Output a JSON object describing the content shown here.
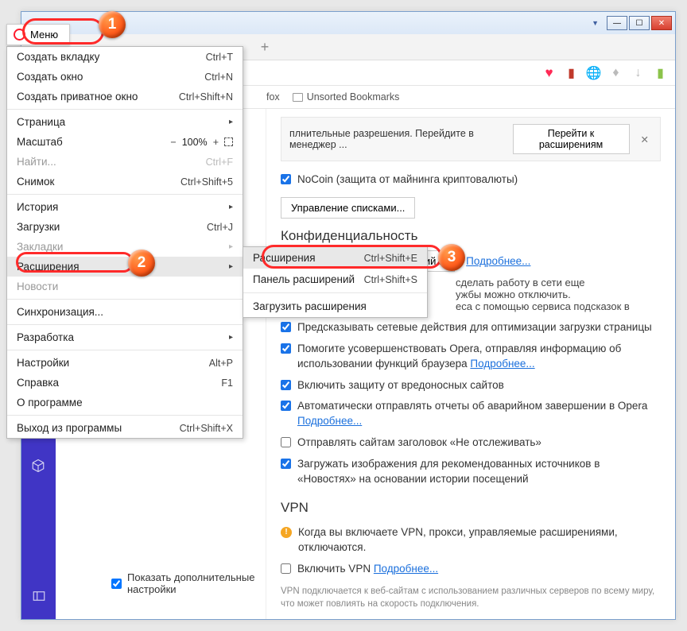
{
  "menu_button": "Меню",
  "bookmark_folders": [
    "fox",
    "Unsorted Bookmarks"
  ],
  "show_advanced": "Показать дополнительные настройки",
  "menu": {
    "new_tab": {
      "label": "Создать вкладку",
      "shortcut": "Ctrl+T"
    },
    "new_window": {
      "label": "Создать окно",
      "shortcut": "Ctrl+N"
    },
    "new_private": {
      "label": "Создать приватное окно",
      "shortcut": "Ctrl+Shift+N"
    },
    "page": {
      "label": "Страница"
    },
    "zoom_label": "Масштаб",
    "zoom_value": "100%",
    "find": {
      "label": "Найти...",
      "shortcut": "Ctrl+F"
    },
    "snapshot": {
      "label": "Снимок",
      "shortcut": "Ctrl+Shift+5"
    },
    "history": {
      "label": "История"
    },
    "downloads": {
      "label": "Загрузки",
      "shortcut": "Ctrl+J"
    },
    "bookmarks": {
      "label": "Закладки"
    },
    "extensions": {
      "label": "Расширения"
    },
    "news": {
      "label": "Новости"
    },
    "sync": {
      "label": "Синхронизация..."
    },
    "develop": {
      "label": "Разработка"
    },
    "settings": {
      "label": "Настройки",
      "shortcut": "Alt+P"
    },
    "help": {
      "label": "Справка",
      "shortcut": "F1"
    },
    "about": {
      "label": "О программе"
    },
    "exit": {
      "label": "Выход из программы",
      "shortcut": "Ctrl+Shift+X"
    }
  },
  "submenu": {
    "extensions": {
      "label": "Расширения",
      "shortcut": "Ctrl+Shift+E"
    },
    "panel": {
      "label": "Панель расширений",
      "shortcut": "Ctrl+Shift+S"
    },
    "load": {
      "label": "Загрузить расширения"
    }
  },
  "notice": {
    "text": "плнительные разрешения. Перейдите в менеджер ...",
    "button": "Перейти к расширениям"
  },
  "nocoin": "NoCoin (защита от майнинга криптовалюты)",
  "manage_lists": "Управление списками...",
  "privacy_h": "Конфиденциальность",
  "clear_history": "Очистить историю посещений...",
  "more": "Подробнее...",
  "priv_txt1": "сделать работу в сети еще",
  "priv_txt2": "ужбы можно отключить.",
  "priv_txt3": "еса с помощью сервиса подсказок в",
  "predict": "Предсказывать сетевые действия для оптимизации загрузки страницы",
  "help_improve": "Помогите усовершенствовать Opera, отправляя информацию об использовании функций браузера",
  "malware": "Включить защиту от вредоносных сайтов",
  "crash": "Автоматически отправлять отчеты об аварийном завершении в Opera",
  "dnt": "Отправлять сайтам заголовок «Не отслеживать»",
  "news_img": "Загружать изображения для рекомендованных источников в «Новостях» на основании истории посещений",
  "vpn_h": "VPN",
  "vpn_warn": "Когда вы включаете VPN, прокси, управляемые расширениями, отключаются.",
  "vpn_enable": "Включить VPN",
  "vpn_note": "VPN подключается к веб-сайтам с использованием различных серверов по всему миру, что может повлиять на скорость подключения."
}
